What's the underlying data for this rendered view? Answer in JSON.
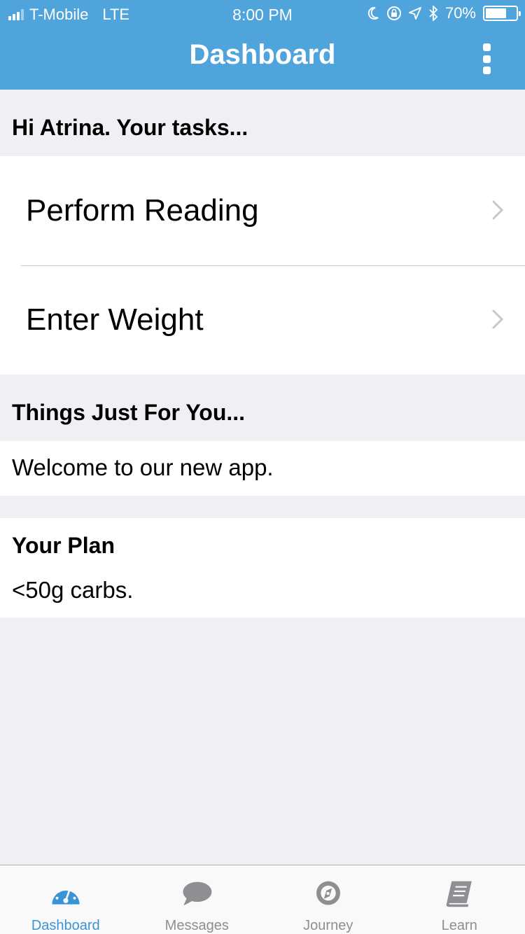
{
  "status": {
    "carrier": "T-Mobile",
    "network": "LTE",
    "time": "8:00 PM",
    "battery": "70%",
    "battery_level": 0.7
  },
  "nav": {
    "title": "Dashboard"
  },
  "tasks": {
    "header": "Hi Atrina. Your tasks...",
    "items": [
      {
        "label": "Perform Reading"
      },
      {
        "label": "Enter Weight"
      }
    ]
  },
  "things": {
    "header": "Things Just For You...",
    "message": "Welcome to our new app."
  },
  "plan": {
    "title": "Your Plan",
    "text": "<50g carbs."
  },
  "tabs": [
    {
      "label": "Dashboard",
      "icon": "dashboard-gauge-icon",
      "active": true
    },
    {
      "label": "Messages",
      "icon": "chat-bubble-icon",
      "active": false
    },
    {
      "label": "Journey",
      "icon": "compass-icon",
      "active": false
    },
    {
      "label": "Learn",
      "icon": "book-icon",
      "active": false
    }
  ],
  "colors": {
    "accent": "#4fa4dc",
    "tab_active": "#3a94d4",
    "tab_inactive": "#8e8e93",
    "background": "#efeff4"
  }
}
